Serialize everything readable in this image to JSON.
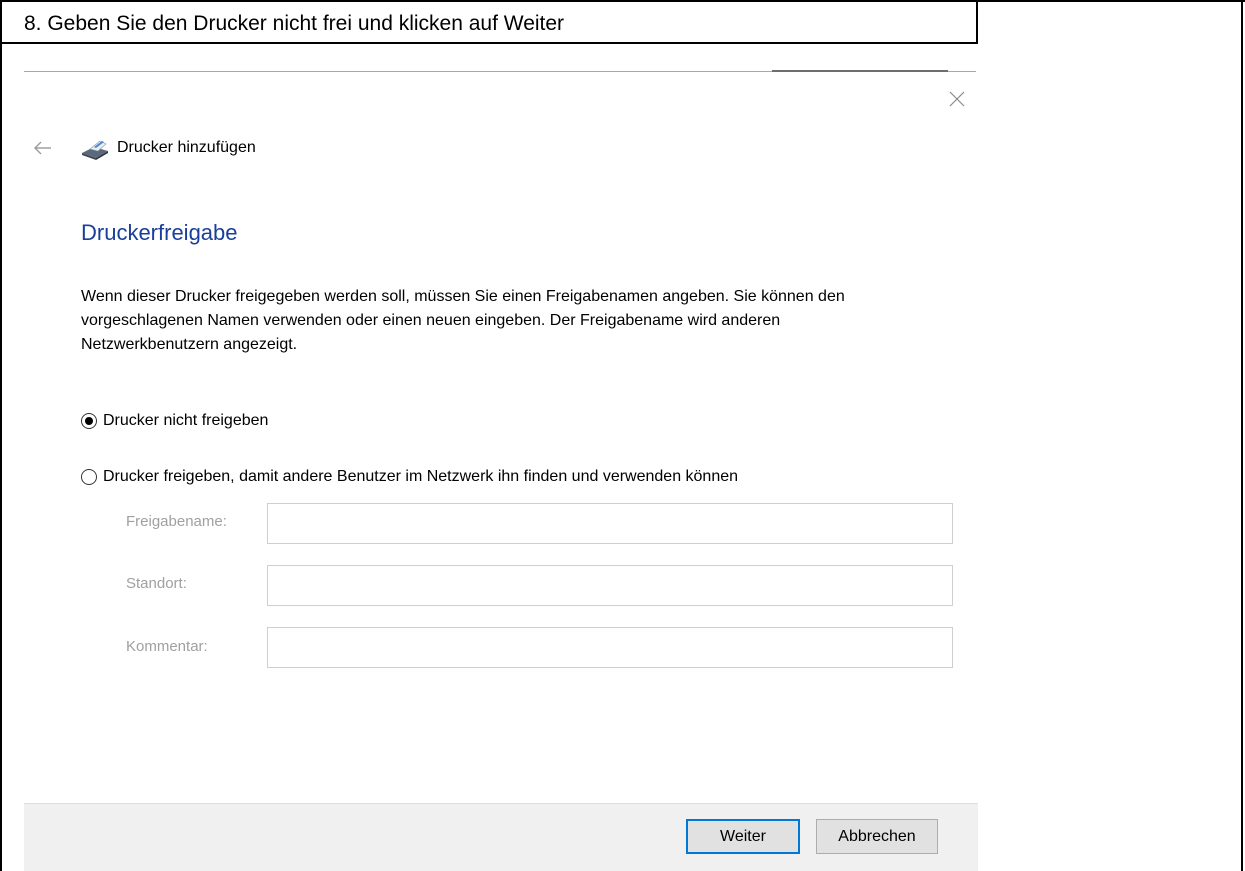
{
  "caption": "8. Geben Sie den Drucker nicht frei und klicken auf Weiter",
  "dialog": {
    "wizard_title": "Drucker hinzufügen",
    "heading": "Druckerfreigabe",
    "description": "Wenn dieser Drucker freigegeben werden soll, müssen Sie einen Freigabenamen angeben. Sie können den vorgeschlagenen Namen verwenden oder einen neuen eingeben. Der Freigabename wird anderen Netzwerkbenutzern angezeigt.",
    "options": {
      "no_share": {
        "label": "Drucker nicht freigeben",
        "selected": true
      },
      "share": {
        "label": "Drucker freigeben, damit andere Benutzer im Netzwerk ihn finden und verwenden können",
        "selected": false
      }
    },
    "fields": {
      "share_name": {
        "label": "Freigabename:",
        "value": ""
      },
      "location": {
        "label": "Standort:",
        "value": ""
      },
      "comment": {
        "label": "Kommentar:",
        "value": ""
      }
    },
    "buttons": {
      "next": "Weiter",
      "cancel": "Abbrechen"
    }
  },
  "icons": {
    "close": "close-icon",
    "back": "back-arrow-icon",
    "printer": "printer-icon"
  },
  "colors": {
    "heading": "#1a3f9a",
    "focus_border": "#0078d7",
    "footer_bg": "#f0f0f0"
  }
}
